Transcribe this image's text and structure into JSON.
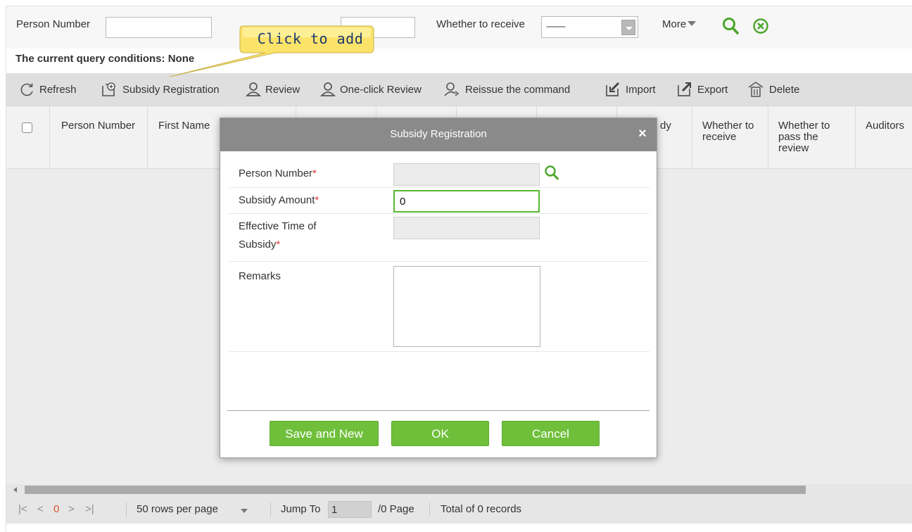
{
  "search": {
    "person_number_label": "Person Number",
    "person_number_value": "",
    "receive_label": "Whether to receive",
    "receive_value": "---------",
    "more_label": "More"
  },
  "query": {
    "label": "The current query conditions:",
    "value": "None"
  },
  "callout": {
    "text": "Click to add",
    "color": "#fbe36a"
  },
  "toolbar": {
    "refresh": "Refresh",
    "subsidy_registration": "Subsidy Registration",
    "review": "Review",
    "one_click_review": "One-click Review",
    "reissue": "Reissue the command",
    "import": "Import",
    "export": "Export",
    "delete": "Delete"
  },
  "grid": {
    "columns": {
      "person_number": "Person Number",
      "first_name": "First Name",
      "subsidy_partial": "dy",
      "whether_to_receive": "Whether to receive",
      "whether_to_pass_review": "Whether to pass the review",
      "auditors": "Auditors"
    }
  },
  "pager": {
    "current_page": "0",
    "rows_per_page": "50 rows per page",
    "jump_to_label": "Jump To",
    "jump_to_value": "1",
    "page_suffix": "/0 Page",
    "total": "Total of 0 records"
  },
  "modal": {
    "title": "Subsidy Registration",
    "person_number_label": "Person Number",
    "person_number_value": "",
    "subsidy_amount_label": "Subsidy Amount",
    "subsidy_amount_value": "0",
    "effective_time_label_line1": "Effective Time of",
    "effective_time_label_line2": "Subsidy",
    "effective_time_value": "",
    "remarks_label": "Remarks",
    "remarks_value": "",
    "required_mark": "*",
    "save_and_new": "Save and New",
    "ok": "OK",
    "cancel": "Cancel",
    "close_symbol": "×"
  },
  "colors": {
    "accent_green": "#6fbf3b",
    "required_red": "#e03c3c",
    "modal_header": "#8a8a8a",
    "pager_current": "#e0552c"
  }
}
